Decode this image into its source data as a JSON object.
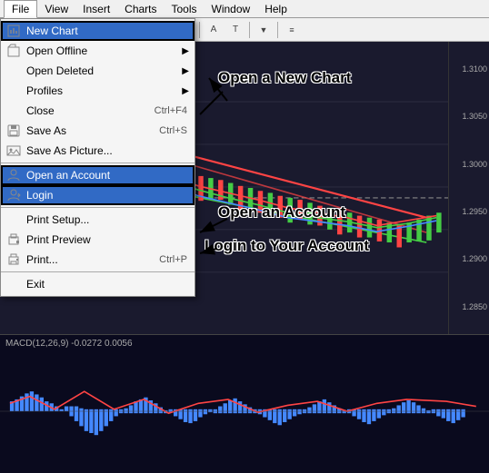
{
  "menubar": {
    "items": [
      "File",
      "View",
      "Insert",
      "Charts",
      "Tools",
      "Window",
      "Help"
    ],
    "active": "File"
  },
  "dropdown": {
    "items": [
      {
        "label": "New Chart",
        "shortcut": "",
        "hasIcon": true,
        "iconType": "chart",
        "highlighted": true,
        "hasSub": false,
        "separator_after": false
      },
      {
        "label": "Open Offline",
        "shortcut": "",
        "hasIcon": false,
        "highlighted": false,
        "hasSub": true,
        "separator_after": false
      },
      {
        "label": "Open Deleted",
        "shortcut": "",
        "hasIcon": false,
        "highlighted": false,
        "hasSub": true,
        "separator_after": false
      },
      {
        "label": "Profiles",
        "shortcut": "",
        "hasIcon": false,
        "highlighted": false,
        "hasSub": true,
        "separator_after": false
      },
      {
        "label": "Close",
        "shortcut": "Ctrl+F4",
        "hasIcon": false,
        "highlighted": false,
        "hasSub": false,
        "separator_after": false
      },
      {
        "label": "Save As",
        "shortcut": "Ctrl+S",
        "hasIcon": true,
        "iconType": "save",
        "highlighted": false,
        "hasSub": false,
        "separator_after": false
      },
      {
        "label": "Save As Picture...",
        "shortcut": "",
        "hasIcon": true,
        "iconType": "picture",
        "highlighted": false,
        "hasSub": false,
        "separator_after": true
      },
      {
        "label": "Open an Account",
        "shortcut": "",
        "hasIcon": true,
        "iconType": "account",
        "highlighted": true,
        "hasSub": false,
        "separator_after": false
      },
      {
        "label": "Login",
        "shortcut": "",
        "hasIcon": true,
        "iconType": "login",
        "highlighted": true,
        "hasSub": false,
        "separator_after": true
      },
      {
        "label": "Print Setup...",
        "shortcut": "",
        "hasIcon": false,
        "highlighted": false,
        "hasSub": false,
        "separator_after": false
      },
      {
        "label": "Print Preview",
        "shortcut": "",
        "hasIcon": true,
        "iconType": "preview",
        "highlighted": false,
        "hasSub": false,
        "separator_after": false
      },
      {
        "label": "Print...",
        "shortcut": "Ctrl+P",
        "hasIcon": true,
        "iconType": "print",
        "highlighted": false,
        "hasSub": false,
        "separator_after": true
      },
      {
        "label": "Exit",
        "shortcut": "",
        "hasIcon": false,
        "highlighted": false,
        "hasSub": false,
        "separator_after": false
      }
    ]
  },
  "annotations": {
    "new_chart": "Open a New Chart",
    "open_account": "Open an Account",
    "login": "Login to Your Account"
  },
  "macd": {
    "label": "MACD(12,26,9) -0.0272  0.0056"
  },
  "chart": {
    "yLabels": [
      "1.3100",
      "1.3050",
      "1.3000",
      "1.2950",
      "1.2900",
      "1.2850"
    ]
  }
}
